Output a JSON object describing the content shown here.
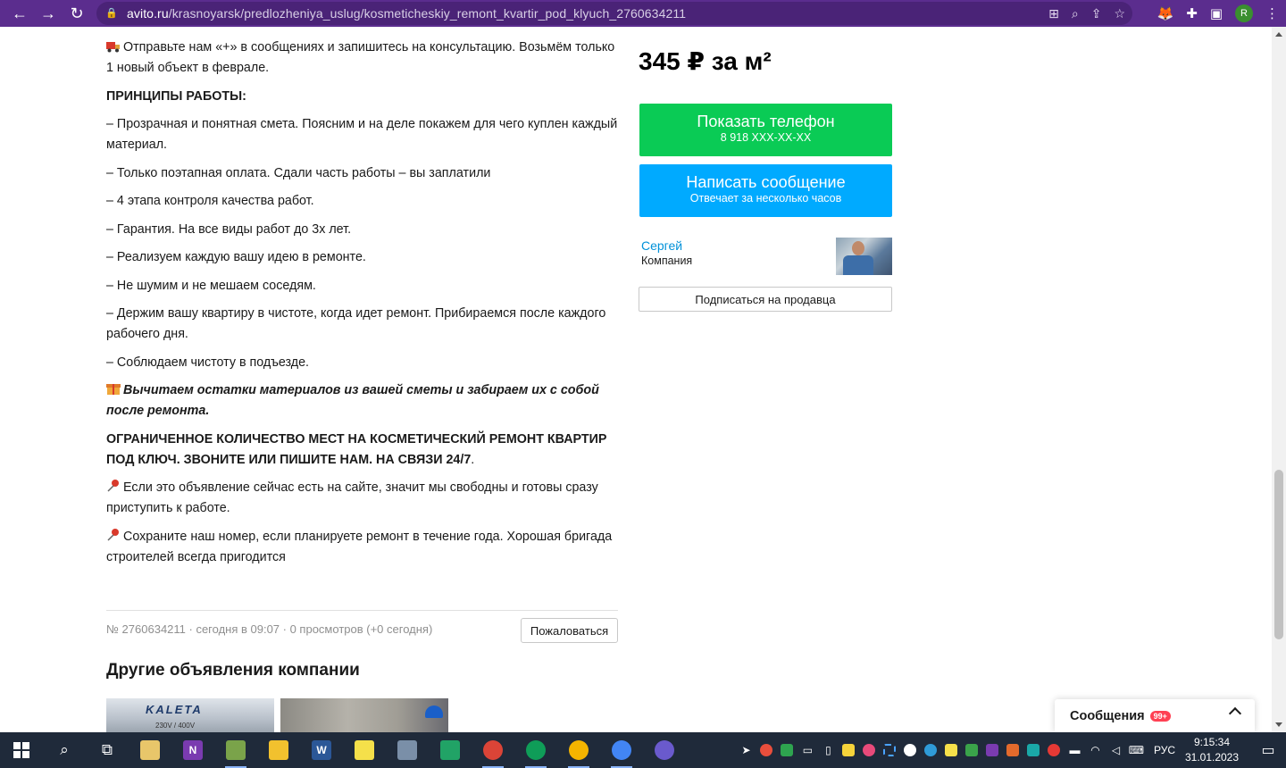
{
  "browser": {
    "url_host": "avito.ru",
    "url_path": "/krasnoyarsk/predlozheniya_uslug/kosmeticheskiy_remont_kvartir_pod_klyuch_2760634211",
    "profile_initial": "R"
  },
  "listing": {
    "paragraphs": [
      {
        "icon": "truck-emoji-icon",
        "text": "Отправьте нам «+» в сообщениях и запишитесь на консультацию. Возьмём только 1 новый объект в феврале.",
        "style": "normal"
      },
      {
        "icon": "",
        "text": "ПРИНЦИПЫ РАБОТЫ:",
        "style": "bold"
      },
      {
        "icon": "",
        "text": "– Прозрачная и понятная смета. Поясним и на деле покажем для чего куплен каждый материал.",
        "style": "normal"
      },
      {
        "icon": "",
        "text": "– Только поэтапная оплата. Сдали часть работы – вы заплатили",
        "style": "normal"
      },
      {
        "icon": "",
        "text": "– 4 этапа контроля качества работ.",
        "style": "normal"
      },
      {
        "icon": "",
        "text": "– Гарантия. На все виды работ до 3х лет.",
        "style": "normal"
      },
      {
        "icon": "",
        "text": "– Реализуем каждую вашу идею в ремонте.",
        "style": "normal"
      },
      {
        "icon": "",
        "text": "– Не шумим и не мешаем соседям.",
        "style": "normal"
      },
      {
        "icon": "",
        "text": "– Держим вашу квартиру в чистоте, когда идет ремонт. Прибираемся после каждого рабочего дня.",
        "style": "normal"
      },
      {
        "icon": "",
        "text": "– Соблюдаем чистоту в подъезде.",
        "style": "normal"
      },
      {
        "icon": "gift-emoji-icon",
        "text": "Вычитаем остатки материалов из вашей сметы и забираем их с собой после ремонта.",
        "style": "bold-italic"
      },
      {
        "icon": "",
        "text": "ОГРАНИЧЕННОЕ КОЛИЧЕСТВО МЕСТ НА КОСМЕТИЧЕСКИЙ РЕМОНТ КВАРТИР ПОД КЛЮЧ. ЗВОНИТЕ ИЛИ ПИШИТЕ НАМ. НА СВЯЗИ 24/7",
        "tail": ".",
        "style": "bold"
      },
      {
        "icon": "pushpin-emoji-icon",
        "text": "Если это объявление сейчас есть на сайте, значит мы свободны и готовы сразу приступить к работе.",
        "style": "normal"
      },
      {
        "icon": "pushpin-emoji-icon",
        "text": "Сохраните наш номер, если планируете ремонт в течение года. Хорошая бригада строителей всегда пригодится",
        "style": "normal"
      }
    ],
    "meta": "№ 2760634211 · сегодня в 09:07 · 0 просмотров (+0 сегодня)",
    "complain_label": "Пожаловаться",
    "other_ads_title": "Другие объявления компании",
    "thumb1_brand": "KALETA",
    "thumb1_sub": "230V / 400V"
  },
  "sidebar": {
    "price": "345 ₽ за м²",
    "phone_button": {
      "label": "Показать телефон",
      "sub": "8 918 XXX-XX-XX"
    },
    "message_button": {
      "label": "Написать сообщение",
      "sub": "Отвечает за несколько часов"
    },
    "seller_name": "Сергей",
    "seller_type": "Компания",
    "subscribe_label": "Подписаться на продавца"
  },
  "messages_widget": {
    "label": "Сообщения",
    "badge": "99+"
  },
  "taskbar": {
    "language": "РУС",
    "time": "9:15:34",
    "date": "31.01.2023"
  },
  "colors": {
    "browser_bar": "#5b2d8e",
    "phone_button": "#0acb55",
    "message_button": "#00aaff",
    "seller_link": "#0091d9"
  }
}
